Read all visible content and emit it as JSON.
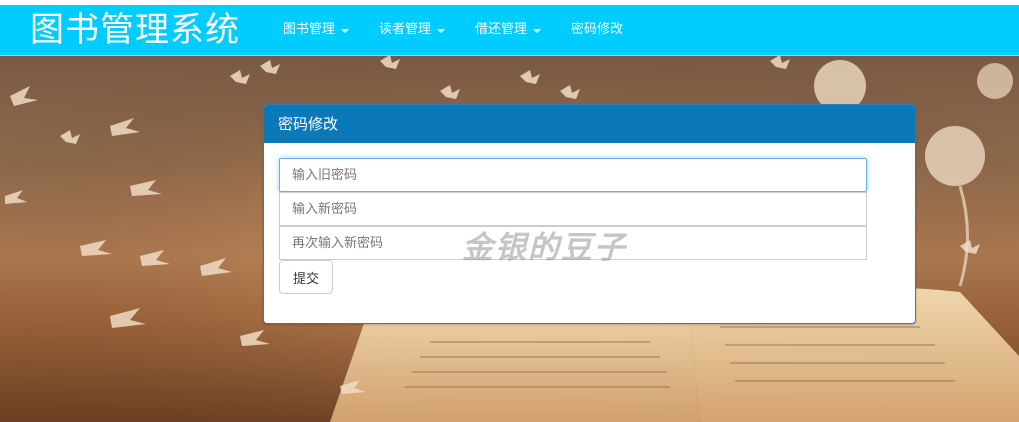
{
  "app": {
    "title": "图书管理系统"
  },
  "nav": {
    "items": [
      {
        "label": "图书管理",
        "dropdown": true
      },
      {
        "label": "读者管理",
        "dropdown": true
      },
      {
        "label": "借还管理",
        "dropdown": true
      },
      {
        "label": "密码修改",
        "dropdown": false
      }
    ]
  },
  "panel": {
    "title": "密码修改",
    "old_password_placeholder": "输入旧密码",
    "new_password_placeholder": "输入新密码",
    "confirm_password_placeholder": "再次输入新密码",
    "submit_label": "提交",
    "watermark": "金银的豆子"
  },
  "colors": {
    "navbar": "#00ccff",
    "panel_heading": "#0b79b7"
  }
}
